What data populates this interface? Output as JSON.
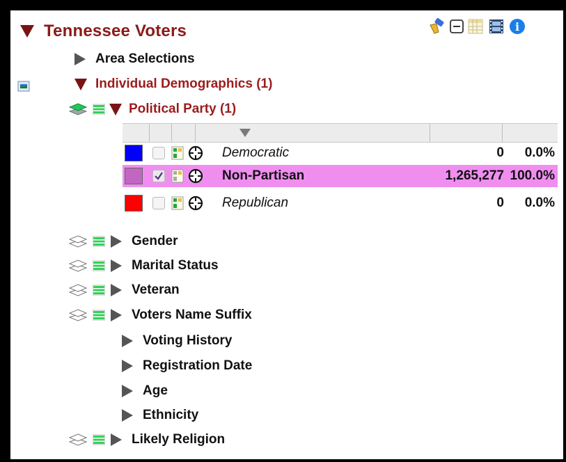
{
  "header": {
    "title": "Tennessee Voters"
  },
  "toolbar": {
    "icons": [
      "clear-brush-icon",
      "collapse-all-icon",
      "table-icon",
      "filmstrip-icon",
      "info-icon"
    ],
    "info_glyph": "i"
  },
  "tree": {
    "area_selections": "Area Selections",
    "individual_demographics": "Individual Demographics (1)",
    "political_party": "Political Party (1)",
    "party_rows": [
      {
        "label": "Democratic",
        "count": "0",
        "pct": "0.0%",
        "color": "#0000ff",
        "checked": false,
        "selected": false
      },
      {
        "label": "Non-Partisan",
        "count": "1,265,277",
        "pct": "100.0%",
        "color": "#c266c2",
        "checked": true,
        "selected": true
      },
      {
        "label": "Republican",
        "count": "0",
        "pct": "0.0%",
        "color": "#ff0000",
        "checked": false,
        "selected": false
      }
    ],
    "categories": [
      {
        "label": "Gender"
      },
      {
        "label": "Marital Status"
      },
      {
        "label": "Veteran"
      },
      {
        "label": "Voters Name Suffix"
      },
      {
        "label": "Voting History"
      },
      {
        "label": "Registration Date"
      },
      {
        "label": "Age"
      },
      {
        "label": "Ethnicity"
      },
      {
        "label": "Likely Religion"
      }
    ]
  },
  "colors": {
    "accent_dark_red": "#8b1a1a",
    "selection_pink": "#f08ef0",
    "layer_green": "#22c55e"
  }
}
